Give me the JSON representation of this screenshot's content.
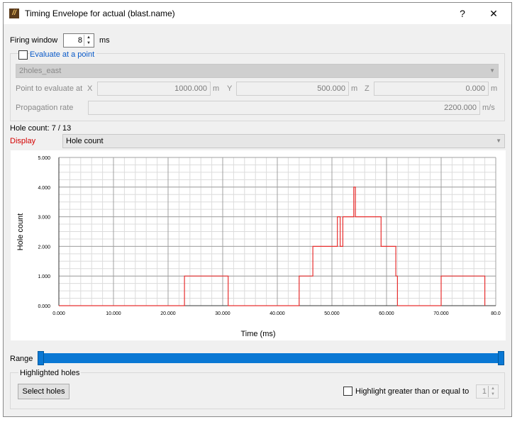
{
  "window": {
    "title": "Timing Envelope for actual (blast.name)",
    "help_label": "?",
    "close_label": "✕"
  },
  "firing_window": {
    "label": "Firing window",
    "value": "8",
    "unit": "ms"
  },
  "evaluate": {
    "checkbox_label": "Evaluate at a point",
    "checked": false,
    "location_value": "2holes_east",
    "point_label": "Point to evaluate at",
    "x_label": "X",
    "x_value": "1000.000",
    "x_unit": "m",
    "y_label": "Y",
    "y_value": "500.000",
    "y_unit": "m",
    "z_label": "Z",
    "z_value": "0.000",
    "z_unit": "m",
    "propagation_label": "Propagation rate",
    "propagation_value": "2200.000",
    "propagation_unit": "m/s"
  },
  "hole_count_text": "Hole count: 7 / 13",
  "display": {
    "label": "Display",
    "value": "Hole count",
    "label_color": "#d40000"
  },
  "chart_data": {
    "type": "line",
    "xlabel": "Time (ms)",
    "ylabel": "Hole count",
    "xlim": [
      0,
      80
    ],
    "ylim": [
      0,
      5
    ],
    "x_ticks": [
      "0.000",
      "10.000",
      "20.000",
      "30.000",
      "40.000",
      "50.000",
      "60.000",
      "70.000",
      "80.0"
    ],
    "y_ticks": [
      "0.000",
      "1.000",
      "2.000",
      "3.000",
      "4.000",
      "5.000"
    ],
    "grid": true,
    "line_color": "#e83030",
    "series": [
      {
        "x": [
          0,
          23,
          23,
          31,
          31,
          44,
          44,
          46.5,
          46.5,
          51,
          51,
          51.5,
          51.5,
          52,
          52,
          54,
          54,
          54.3,
          54.3,
          54.5,
          54.5,
          59,
          59,
          61.7,
          61.7,
          62,
          62,
          70,
          70,
          78,
          78
        ],
        "y": [
          0,
          0,
          1,
          1,
          0,
          0,
          1,
          1,
          2,
          2,
          3,
          3,
          2,
          2,
          3,
          3,
          4,
          4,
          3,
          3,
          3,
          3,
          2,
          2,
          1,
          1,
          0,
          0,
          1,
          1,
          0
        ]
      }
    ]
  },
  "range_label": "Range",
  "range_slider": {
    "low": 0,
    "high": 1,
    "accent": "#0a78d4"
  },
  "highlighted": {
    "group_label": "Highlighted holes",
    "select_button": "Select holes",
    "highlight_label": "Highlight greater than or equal to",
    "highlight_value": "1",
    "checked": false
  }
}
